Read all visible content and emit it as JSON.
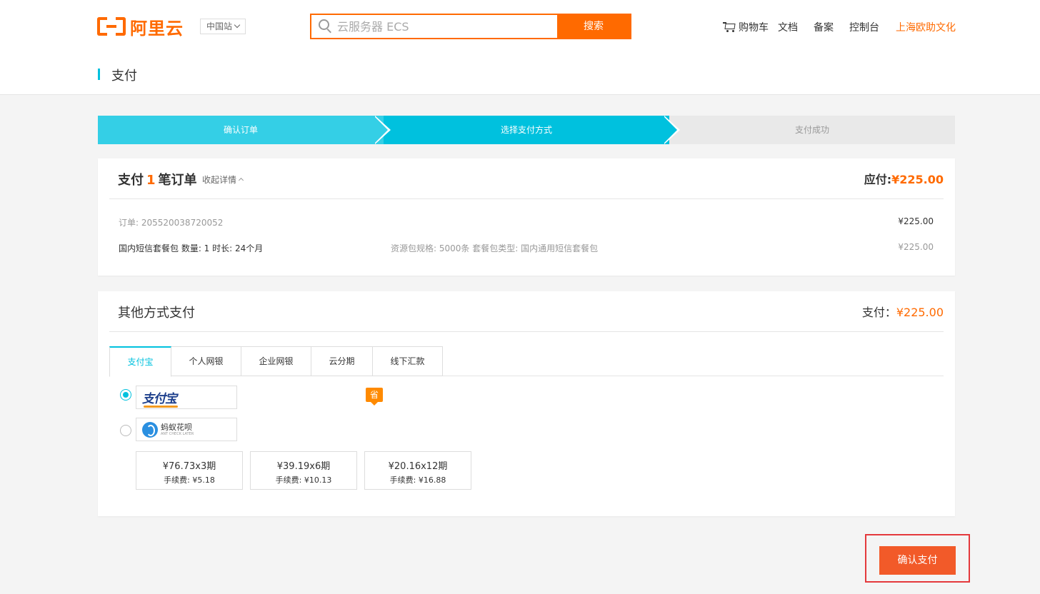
{
  "header": {
    "logo_text": "阿里云",
    "region_label": "中国站",
    "search": {
      "placeholder": "云服务器 ECS",
      "button_label": "搜索"
    },
    "nav": {
      "cart": "购物车",
      "docs": "文档",
      "beian": "备案",
      "console": "控制台",
      "user": "上海欧助文化"
    }
  },
  "page": {
    "title": "支付"
  },
  "steps": [
    "确认订单",
    "选择支付方式",
    "支付成功"
  ],
  "order": {
    "title_prefix": "支付",
    "count": "1",
    "title_suffix": "笔订单",
    "collapse_label": "收起详情",
    "due_label": "应付:",
    "due_amount": "¥225.00",
    "order_no": "订单: 205520038720052",
    "order_amount": "¥225.00",
    "product": "国内短信套餐包 数量: 1 时长: 24个月",
    "spec": "资源包规格: 5000条 套餐包类型: 国内通用短信套餐包",
    "product_amount": "¥225.00"
  },
  "payment": {
    "title": "其他方式支付",
    "total_label": "支付：",
    "total_amount": "¥225.00",
    "tabs": [
      "支付宝",
      "个人网银",
      "企业网银",
      "云分期",
      "线下汇款"
    ],
    "tab_badge": "省",
    "methods": {
      "alipay": "支付宝",
      "huabei_name": "蚂蚁花呗",
      "huabei_sub": "ANT CHECK LATER"
    },
    "plans": [
      {
        "amount": "¥76.73x3期",
        "fee": "手续费: ¥5.18"
      },
      {
        "amount": "¥39.19x6期",
        "fee": "手续费: ¥10.13"
      },
      {
        "amount": "¥20.16x12期",
        "fee": "手续费: ¥16.88"
      }
    ]
  },
  "confirm_label": "确认支付",
  "colors": {
    "brand": "#ff6a00",
    "accent": "#00c1de",
    "confirm": "#f25a29",
    "highlight": "#e4393c"
  }
}
